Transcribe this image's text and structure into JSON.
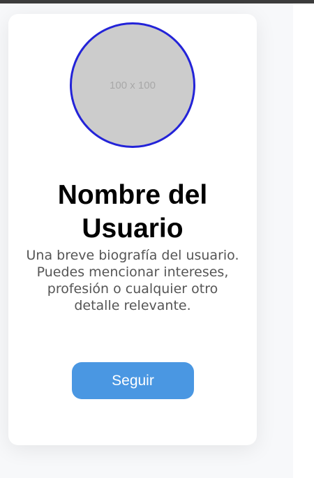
{
  "profile": {
    "avatar_placeholder": "100 x 100",
    "name": "Nombre del Usuario",
    "bio": "Una breve biografía del usuario. Puedes mencionar intereses, profesión o cualquier otro detalle relevante.",
    "follow_label": "Seguir"
  },
  "colors": {
    "accent": "#4a97e2",
    "avatar_border": "#2323d8"
  }
}
